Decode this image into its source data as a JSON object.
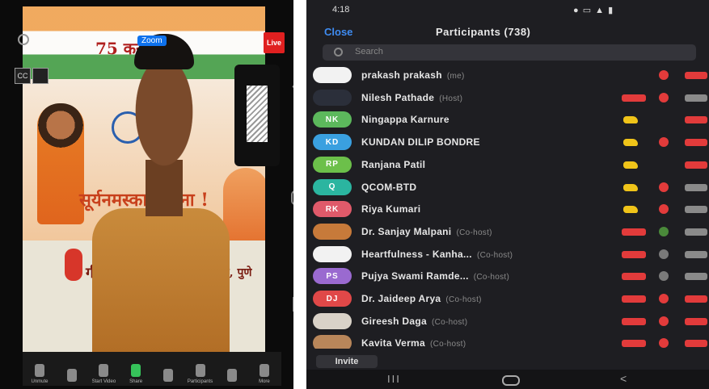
{
  "zoom_view": {
    "banner_top_text": "75 करो          कार",
    "banner_main_text": "सूर्यनमस्का             रवंदना !",
    "banner_bottom_text": "गीत",
    "banner_bottom_right": "र, पुणे",
    "zoom_badge": "Zoom",
    "live_label": "Live",
    "cc_label": "CC",
    "toolbar": [
      {
        "label": "Unmute",
        "icon": "microphone-icon"
      },
      {
        "label": "",
        "icon": "audio-icon"
      },
      {
        "label": "Start Video",
        "icon": "video-camera-icon"
      },
      {
        "label": "Share",
        "icon": "share-screen-icon",
        "color": "#36c25a"
      },
      {
        "label": "",
        "icon": "reactions-icon"
      },
      {
        "label": "Participants",
        "icon": "participants-icon"
      },
      {
        "label": "",
        "icon": "chat-icon"
      },
      {
        "label": "More",
        "icon": "more-icon"
      }
    ]
  },
  "phone": {
    "status_time": "4:18",
    "header": {
      "close_label": "Close",
      "title": "Participants (738)"
    },
    "search_placeholder": "Search",
    "participants": [
      {
        "name": "prakash prakash",
        "role": "(me)",
        "initials": "",
        "avatar_color": "#f2f2f2",
        "hand": false,
        "video_off": false,
        "mic": "muted",
        "cam": "off"
      },
      {
        "name": "Nilesh Pathade",
        "role": "(Host)",
        "initials": "",
        "avatar_color": "#2b2f3a",
        "hand": false,
        "video_off": true,
        "mic": "muted",
        "cam": "grey"
      },
      {
        "name": "Ningappa Karnure",
        "role": "",
        "initials": "NK",
        "avatar_color": "#5cb85c",
        "hand": true,
        "video_off": false,
        "mic": "none",
        "cam": "off"
      },
      {
        "name": "KUNDAN DILIP BONDRE",
        "role": "",
        "initials": "KD",
        "avatar_color": "#3aa0e0",
        "hand": true,
        "video_off": false,
        "mic": "muted",
        "cam": "off"
      },
      {
        "name": "Ranjana Patil",
        "role": "",
        "initials": "RP",
        "avatar_color": "#6cc04a",
        "hand": true,
        "video_off": false,
        "mic": "none",
        "cam": "off"
      },
      {
        "name": "QCOM-BTD",
        "role": "",
        "initials": "Q",
        "avatar_color": "#2bb5a0",
        "hand": true,
        "video_off": false,
        "mic": "muted",
        "cam": "grey"
      },
      {
        "name": "Riya Kumari",
        "role": "",
        "initials": "RK",
        "avatar_color": "#e05a6a",
        "hand": true,
        "video_off": false,
        "mic": "muted",
        "cam": "grey"
      },
      {
        "name": "Dr. Sanjay Malpani",
        "role": "(Co-host)",
        "initials": "",
        "avatar_color": "#c77a3a",
        "hand": false,
        "video_off": true,
        "mic": "green",
        "cam": "grey"
      },
      {
        "name": "Heartfulness - Kanha...",
        "role": "(Co-host)",
        "initials": "",
        "avatar_color": "#f2f2f2",
        "hand": false,
        "video_off": true,
        "mic": "grey",
        "cam": "grey"
      },
      {
        "name": "Pujya Swami Ramde...",
        "role": "(Co-host)",
        "initials": "PS",
        "avatar_color": "#9a6ad0",
        "hand": false,
        "video_off": true,
        "mic": "grey",
        "cam": "grey"
      },
      {
        "name": "Dr. Jaideep Arya",
        "role": "(Co-host)",
        "initials": "DJ",
        "avatar_color": "#e04848",
        "hand": false,
        "video_off": true,
        "mic": "muted",
        "cam": "off"
      },
      {
        "name": "Gireesh Daga",
        "role": "(Co-host)",
        "initials": "",
        "avatar_color": "#d9d2c8",
        "hand": false,
        "video_off": true,
        "mic": "muted",
        "cam": "off"
      },
      {
        "name": "Kavita Verma",
        "role": "(Co-host)",
        "initials": "",
        "avatar_color": "#b8865a",
        "hand": false,
        "video_off": true,
        "mic": "muted",
        "cam": "off"
      }
    ],
    "invite_label": "Invite",
    "nav": {
      "menu": "III",
      "back": "<"
    }
  }
}
